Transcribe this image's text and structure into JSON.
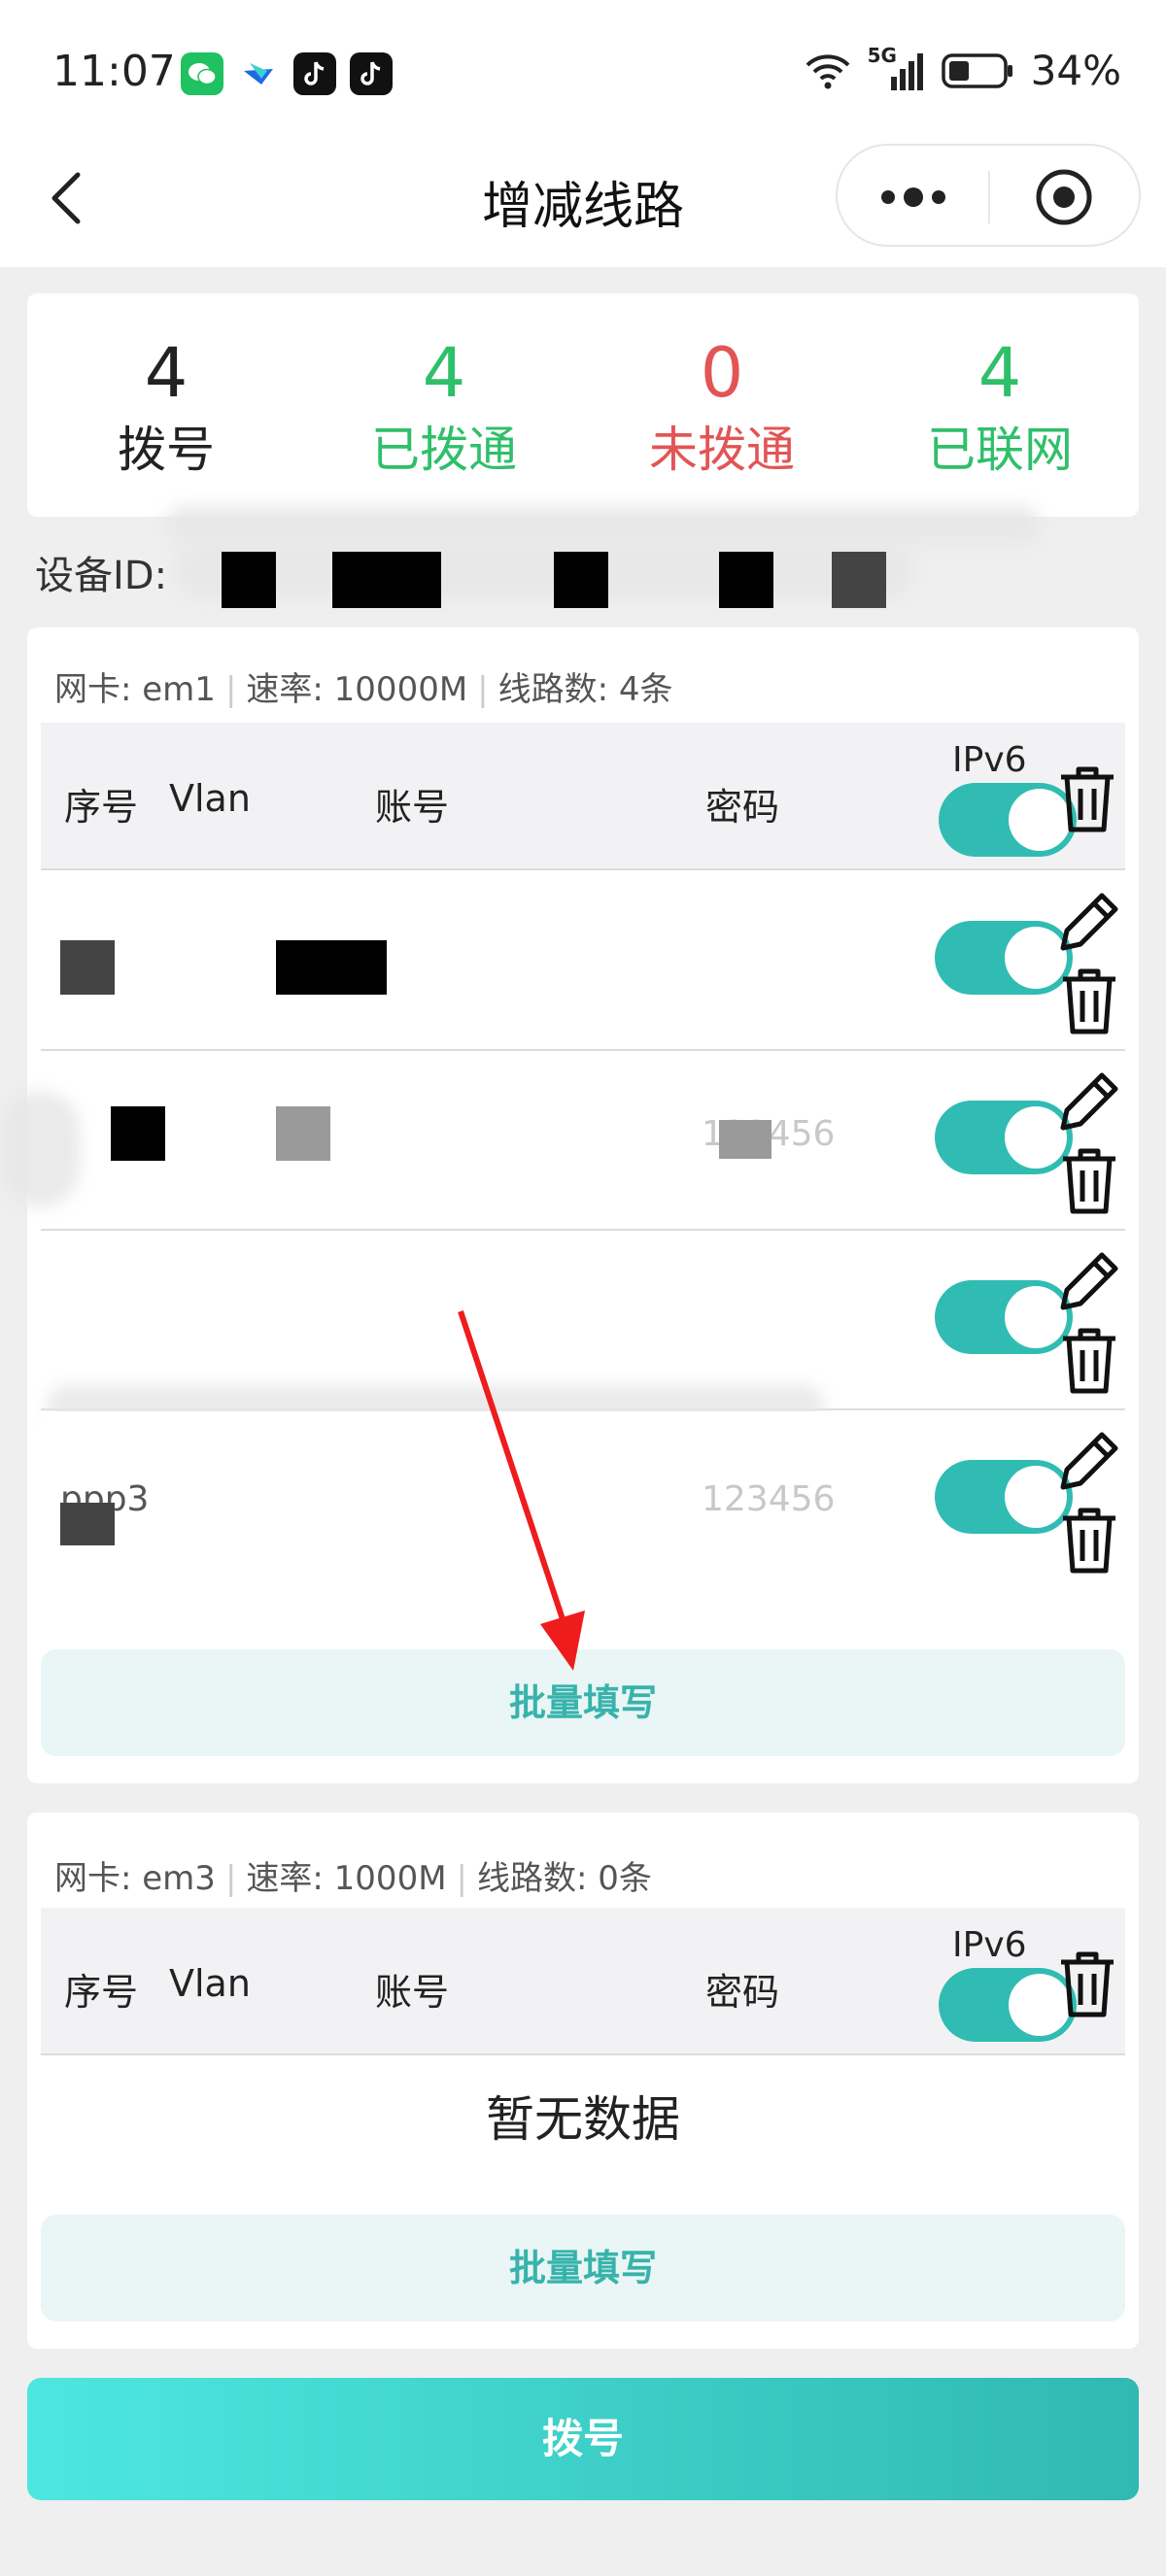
{
  "status_bar": {
    "time": "11:07",
    "network": "5G",
    "battery": "34%"
  },
  "nav": {
    "title": "增减线路"
  },
  "stats": [
    {
      "value": "4",
      "label": "拨号",
      "color": "#222222"
    },
    {
      "value": "4",
      "label": "已拨通",
      "color": "#2fbf6a"
    },
    {
      "value": "0",
      "label": "未拨通",
      "color": "#e25555"
    },
    {
      "value": "4",
      "label": "已联网",
      "color": "#2fbf6a"
    }
  ],
  "device": {
    "label": "设备ID:"
  },
  "table_headers": {
    "index": "序号",
    "vlan": "Vlan",
    "account": "账号",
    "password": "密码",
    "ipv6": "IPv6"
  },
  "nics": [
    {
      "nic_label": "网卡: em1",
      "rate_label": "速率: 10000M",
      "lines_label": "线路数: 4条",
      "rows": [
        {
          "account": "",
          "password": ""
        },
        {
          "account": "",
          "password": "123456"
        },
        {
          "account": "",
          "password": ""
        },
        {
          "account": "ppp3",
          "password": "123456"
        }
      ],
      "batch_label": "批量填写"
    },
    {
      "nic_label": "网卡: em3",
      "rate_label": "速率: 1000M",
      "lines_label": "线路数: 0条",
      "empty_text": "暂无数据",
      "batch_label": "批量填写"
    }
  ],
  "dial_button": "拨号",
  "colors": {
    "accent": "#30bcb2",
    "success": "#2fbf6a",
    "danger": "#e25555",
    "annotation_arrow": "#ee1c1c"
  }
}
